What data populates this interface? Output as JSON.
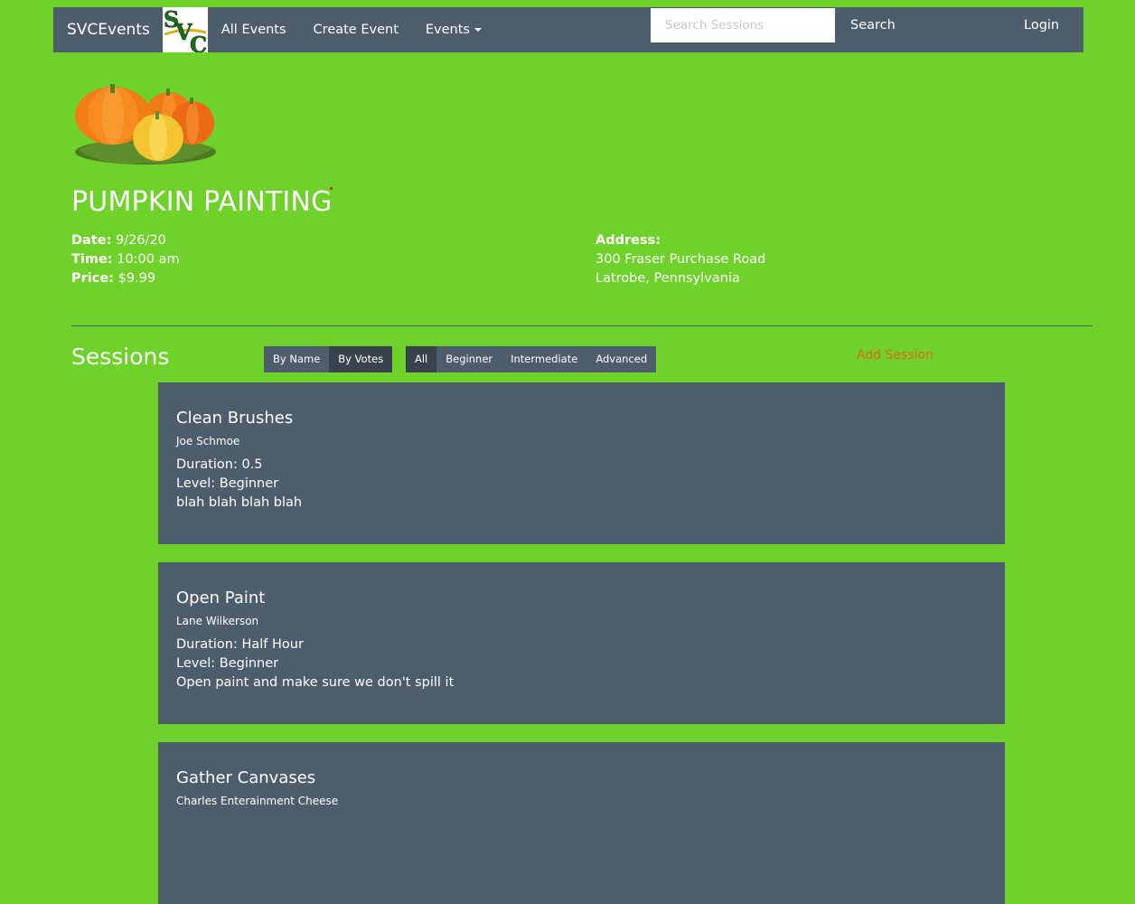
{
  "navbar": {
    "brand": "SVCEvents",
    "logo_text": "SVC",
    "links": [
      "All Events",
      "Create Event",
      "Events"
    ],
    "search_placeholder": "Search Sessions",
    "search_label": "Search",
    "login_label": "Login"
  },
  "event": {
    "title": "PUMPKIN PAINTING",
    "date_label": "Date:",
    "date": "9/26/20",
    "time_label": "Time:",
    "time": "10:00 am",
    "price_label": "Price:",
    "price": "$9.99",
    "address_label": "Address:",
    "address_line1": "300 Fraser Purchase Road",
    "address_line2": "Latrobe, Pennsylvania"
  },
  "sessions": {
    "heading": "Sessions",
    "sort_options": [
      "By Name",
      "By Votes"
    ],
    "sort_active": "By Votes",
    "level_options": [
      "All",
      "Beginner",
      "Intermediate",
      "Advanced"
    ],
    "level_active": "All",
    "add_label": "Add Session",
    "items": [
      {
        "title": "Clean Brushes",
        "speaker": "Joe Schmoe",
        "duration": "Duration: 0.5",
        "level": "Level: Beginner",
        "abstract": "blah blah blah blah"
      },
      {
        "title": "Open Paint",
        "speaker": "Lane Wilkerson",
        "duration": "Duration: Half Hour",
        "level": "Level: Beginner",
        "abstract": "Open paint and make sure we don't spill it"
      },
      {
        "title": "Gather Canvases",
        "speaker": "Charles Enterainment Cheese",
        "duration": "",
        "level": "",
        "abstract": ""
      }
    ]
  },
  "colors": {
    "page_background": "#6ed22a",
    "panel": "#4e5d6c",
    "panel_active": "#39434d",
    "link_accent": "#df691a",
    "logo_green": "#1d6b1f",
    "logo_gold": "#d9b21b"
  }
}
